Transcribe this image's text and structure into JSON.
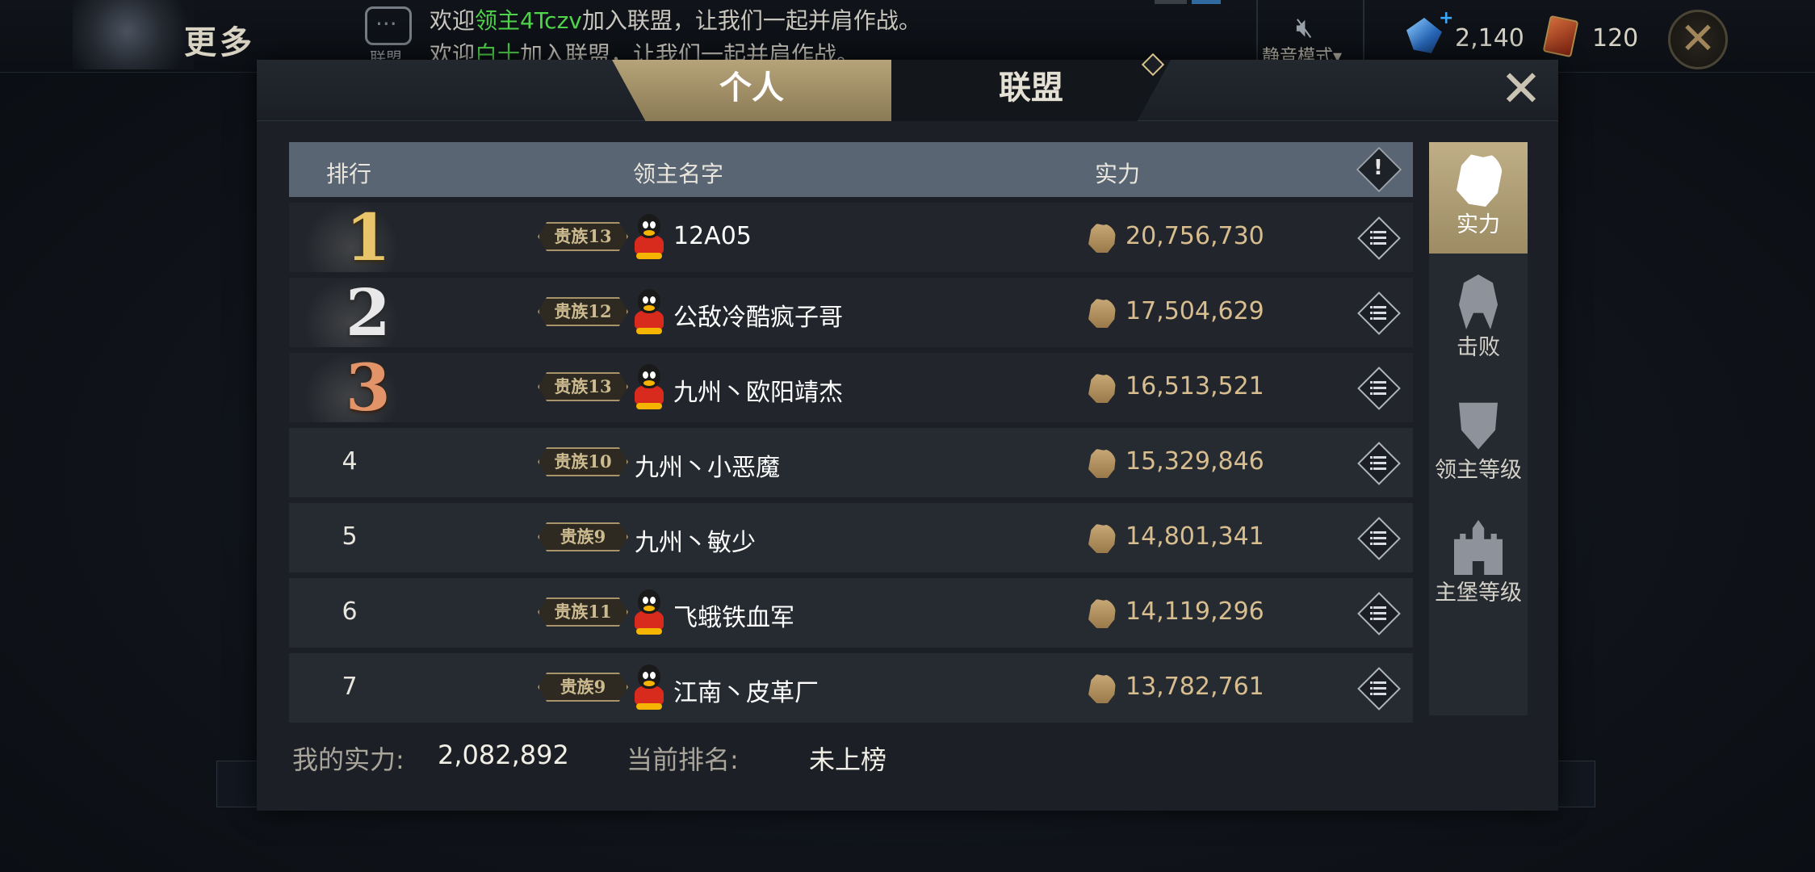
{
  "topbar": {
    "title": "更多",
    "chat_label": "联盟",
    "news": [
      {
        "prefix": "欢迎",
        "highlight": "领主4Tczv",
        "suffix": "加入联盟，让我们一起并肩作战。"
      },
      {
        "prefix": "欢迎",
        "highlight": "白十",
        "suffix": "加入联盟，让我们一起并肩作战。"
      }
    ],
    "mute_label": "静音模式▾",
    "crystals": "2,140",
    "cards": "120",
    "highlight_color": "#4fd34a"
  },
  "tabs": [
    {
      "label": "个人",
      "active": true
    },
    {
      "label": "联盟",
      "active": false
    }
  ],
  "table": {
    "headers": {
      "rank": "排行",
      "name": "领主名字",
      "power": "实力",
      "info": "!"
    },
    "rows": [
      {
        "rank": "1",
        "noble": "贵族13",
        "qq": true,
        "name": "12A05",
        "power": "20,756,730"
      },
      {
        "rank": "2",
        "noble": "贵族12",
        "qq": true,
        "name": "公敌冷酷疯子哥",
        "power": "17,504,629"
      },
      {
        "rank": "3",
        "noble": "贵族13",
        "qq": true,
        "name": "九州丶欧阳靖杰",
        "power": "16,513,521"
      },
      {
        "rank": "4",
        "noble": "贵族10",
        "qq": false,
        "name": "九州丶小恶魔",
        "power": "15,329,846"
      },
      {
        "rank": "5",
        "noble": "贵族9",
        "qq": false,
        "name": "九州丶敏少",
        "power": "14,801,341"
      },
      {
        "rank": "6",
        "noble": "贵族11",
        "qq": true,
        "name": "飞蛾铁血军",
        "power": "14,119,296"
      },
      {
        "rank": "7",
        "noble": "贵族9",
        "qq": true,
        "name": "江南丶皮革厂",
        "power": "13,782,761"
      }
    ]
  },
  "side_tabs": [
    {
      "label": "实力",
      "icon": "fist-icon",
      "active": true
    },
    {
      "label": "击败",
      "icon": "helmet-swords-icon",
      "active": false
    },
    {
      "label": "领主等级",
      "icon": "shield-sword-icon",
      "active": false
    },
    {
      "label": "主堡等级",
      "icon": "castle-icon",
      "active": false
    }
  ],
  "footer": {
    "my_power_label": "我的实力:",
    "my_power_value": "2,082,892",
    "current_rank_label": "当前排名:",
    "current_rank_value": "未上榜"
  },
  "colors": {
    "accent_gold": "#bfae86",
    "power_text": "#d8bd8f",
    "rank_gold": "#e8c46a",
    "rank_silver": "#e8e8e8",
    "rank_bronze": "#e29468"
  }
}
